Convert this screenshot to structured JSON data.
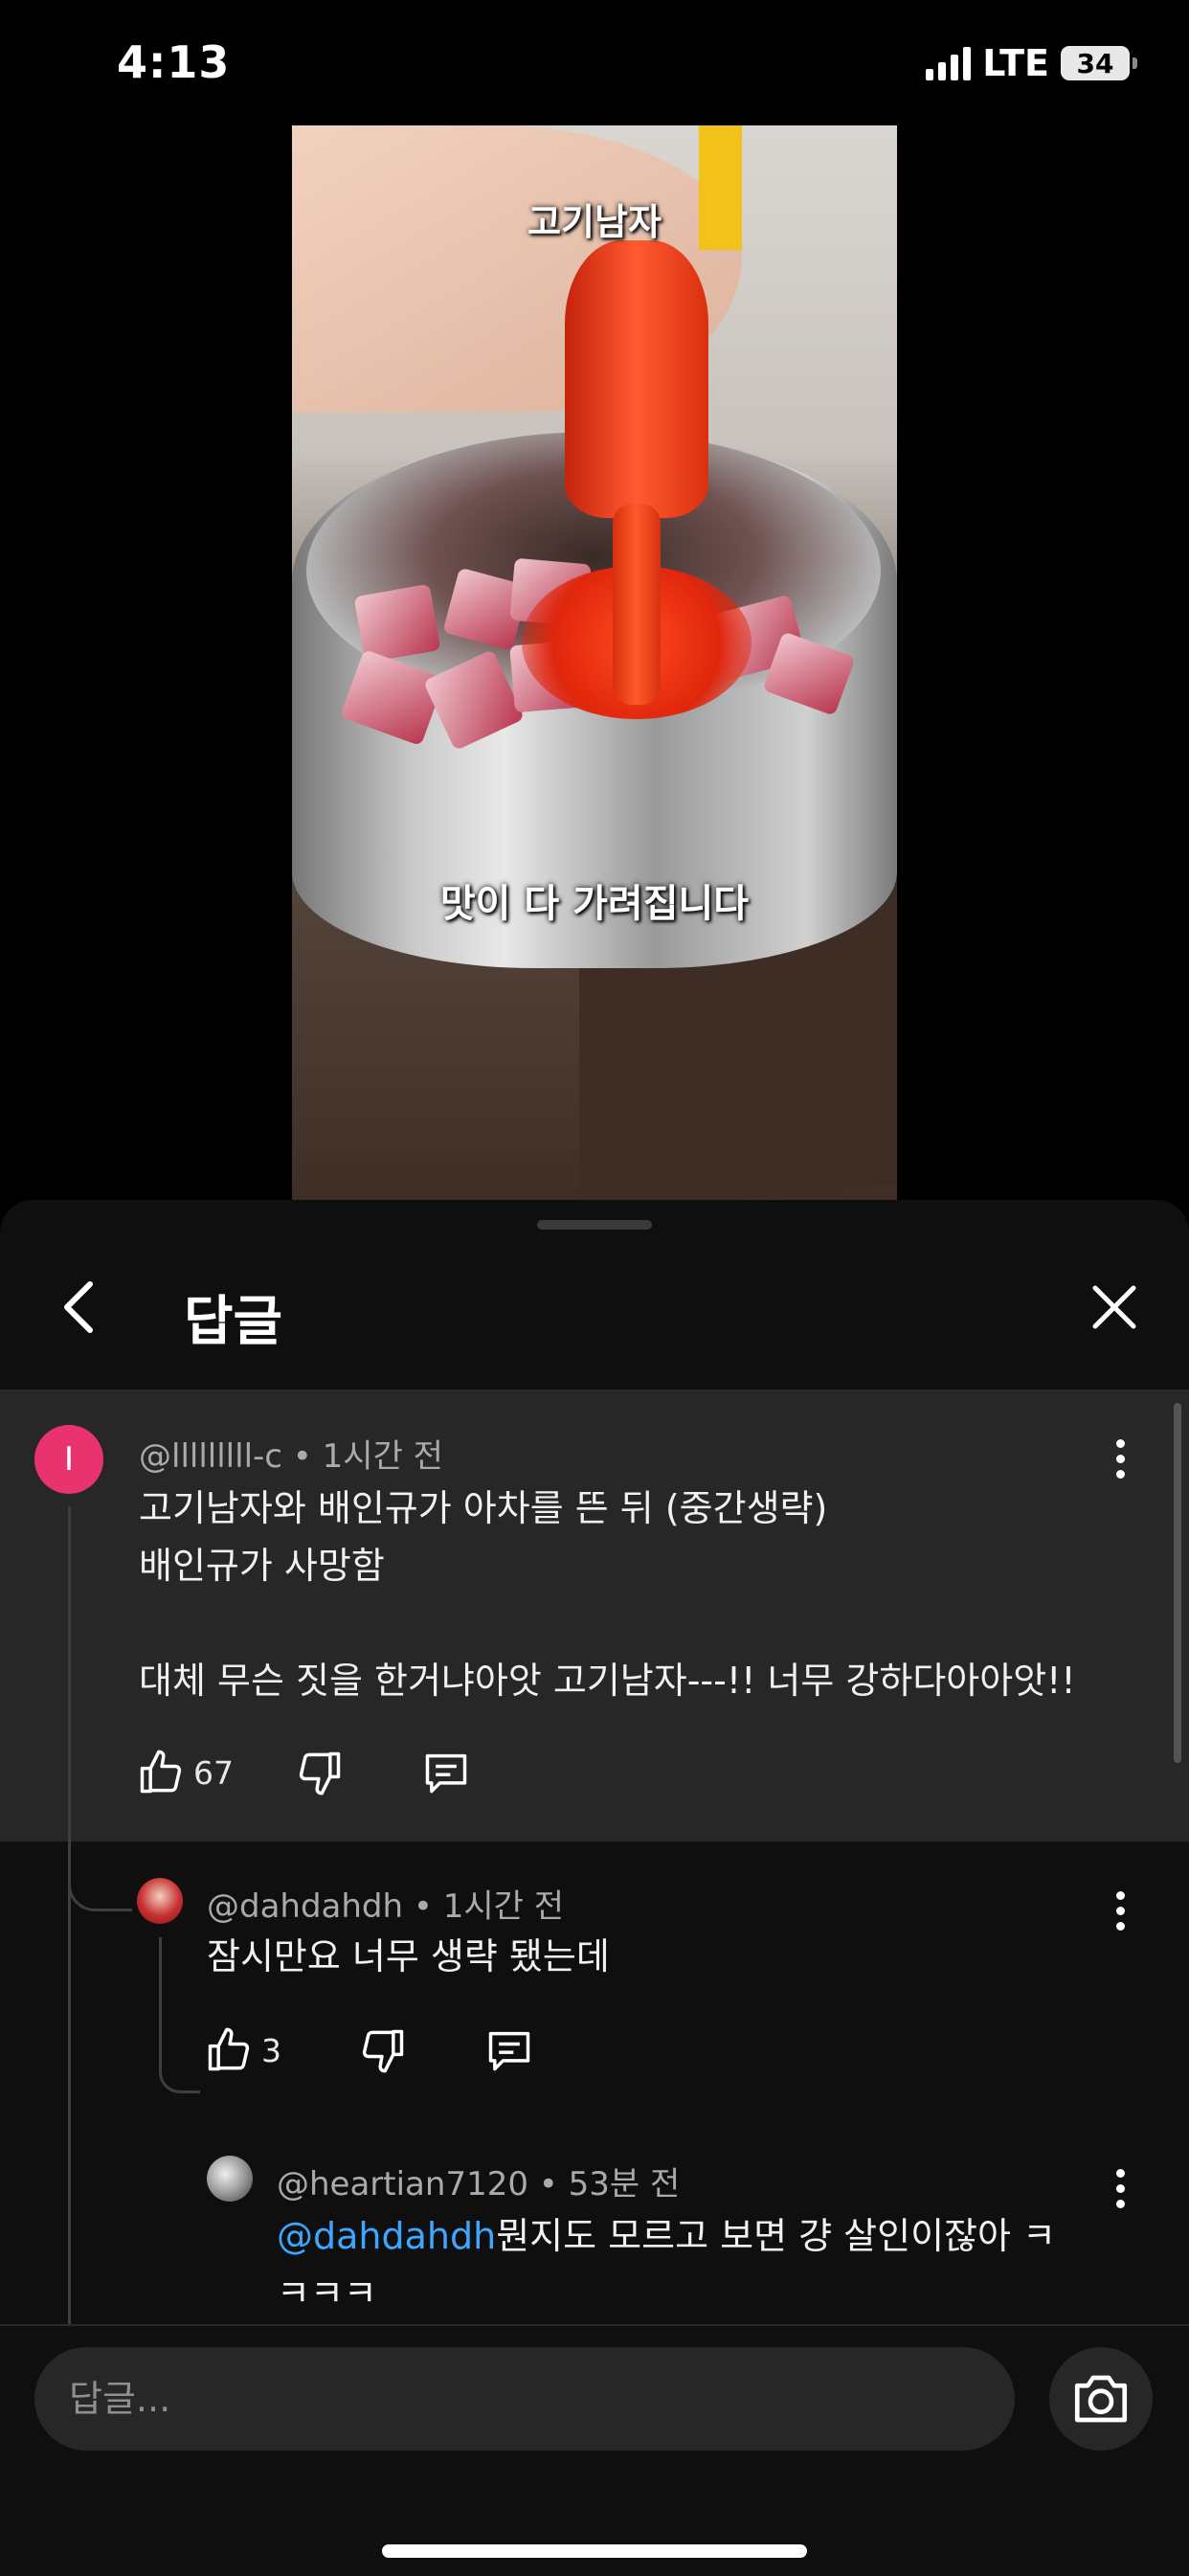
{
  "status_bar": {
    "time": "4:13",
    "network": "LTE",
    "battery": "34"
  },
  "video": {
    "caption_top": "고기남자",
    "caption_bottom": "맛이 다 가려집니다"
  },
  "sheet": {
    "title": "답글",
    "back_icon": "chevron-left-icon",
    "close_icon": "close-icon"
  },
  "comments": [
    {
      "avatar_letter": "I",
      "avatar_color": "#e8336f",
      "author": "@lllllllll-c",
      "time": "1시간 전",
      "lines": [
        "고기남자와 배인규가 아차를 뜬 뒤 (중간생략)",
        "배인규가 사망함",
        "",
        "대체 무슨 짓을 한거냐아앗 고기남자---!! 너무 강하다아아앗!!"
      ],
      "likes": "67"
    },
    {
      "author": "@dahdahdh",
      "time": "1시간 전",
      "lines": [
        "잠시만요 너무 생략 됐는데"
      ],
      "likes": "3"
    },
    {
      "author": "@heartian7120",
      "time": "53분 전",
      "mention": "@dahdahdh",
      "line1_rest": "뭔지도 모르고 보면 걍 살인이잖아 ㅋ",
      "line2": "ㅋㅋㅋ"
    }
  ],
  "composer": {
    "placeholder": "답글...",
    "camera_icon": "camera-icon"
  }
}
